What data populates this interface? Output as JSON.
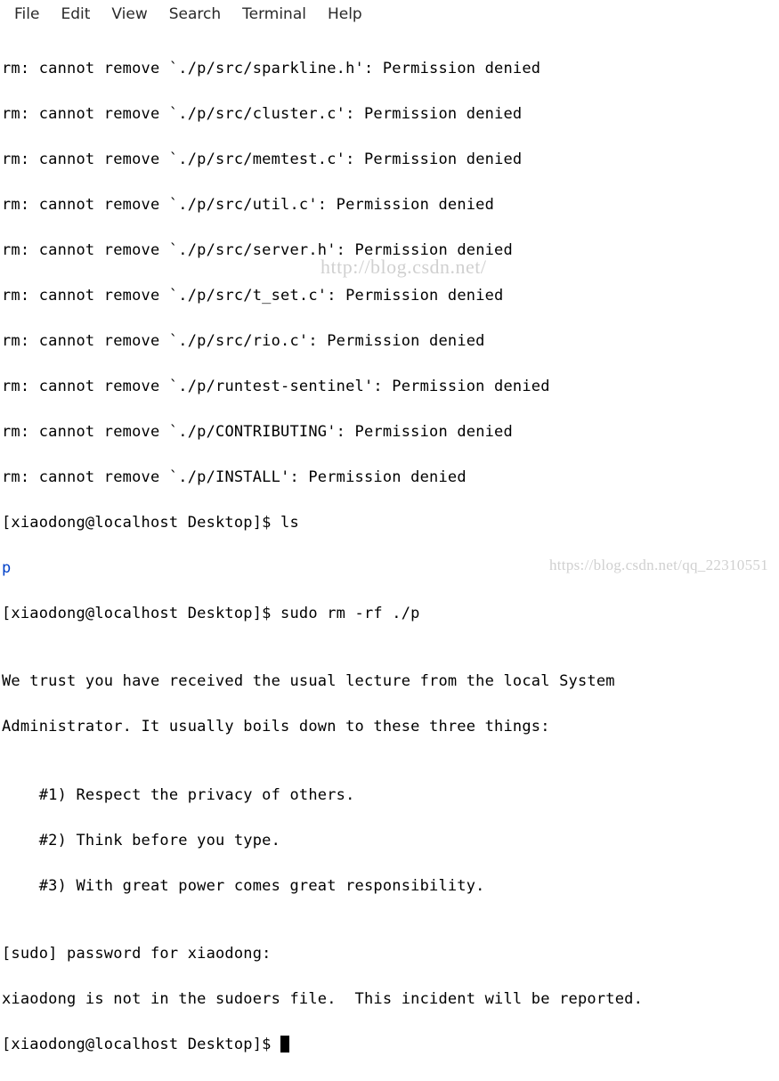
{
  "menubar": {
    "items": [
      "File",
      "Edit",
      "View",
      "Search",
      "Terminal",
      "Help"
    ]
  },
  "terminal": {
    "rm_error_prefix": "rm: cannot remove `",
    "rm_error_suffix": "': Permission denied",
    "errors": [
      "./p/src/sparkline.h",
      "./p/src/cluster.c",
      "./p/src/memtest.c",
      "./p/src/util.c",
      "./p/src/server.h",
      "./p/src/t_set.c",
      "./p/src/rio.c",
      "./p/runtest-sentinel",
      "./p/CONTRIBUTING",
      "./p/INSTALL"
    ],
    "prompt": "[xiaodong@localhost Desktop]$ ",
    "cmd_ls": "ls",
    "ls_output": "p",
    "cmd_sudo": "sudo rm -rf ./p",
    "blank": "",
    "lecture_l1": "We trust you have received the usual lecture from the local System",
    "lecture_l2": "Administrator. It usually boils down to these three things:",
    "lecture_b1": "    #1) Respect the privacy of others.",
    "lecture_b2": "    #2) Think before you type.",
    "lecture_b3": "    #3) With great power comes great responsibility.",
    "pw_prompt": "[sudo] password for xiaodong:",
    "sudo_err": "xiaodong is not in the sudoers file.  This incident will be reported."
  },
  "watermarks": {
    "middle": "http://blog.csdn.net/",
    "bottom": "https://blog.csdn.net/qq_22310551"
  }
}
